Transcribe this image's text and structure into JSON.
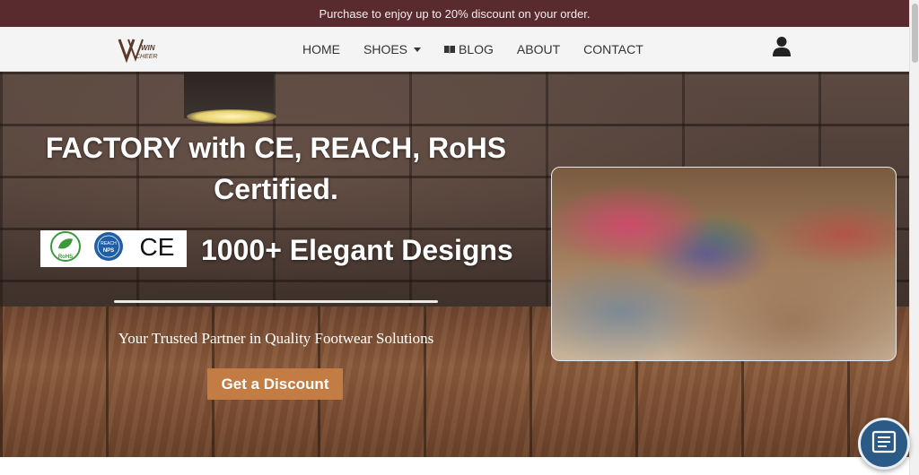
{
  "announcement": {
    "text": "Purchase to enjoy up to 20% discount on your order."
  },
  "brand": {
    "logo_alt": "VVIN CHEER",
    "logo_line1": "WIN",
    "logo_line2": "CHEER"
  },
  "nav": {
    "items": [
      {
        "label": "HOME",
        "icon": null
      },
      {
        "label": "SHOES",
        "icon": "chevron-down-icon"
      },
      {
        "label": "BLOG",
        "icon": "book-icon"
      },
      {
        "label": "ABOUT",
        "icon": null
      },
      {
        "label": "CONTACT",
        "icon": null
      }
    ],
    "account_icon": "user-icon"
  },
  "hero": {
    "headline": "FACTORY with CE, REACH, RoHS Certified.",
    "certifications": [
      "RoHS",
      "REACH",
      "CE"
    ],
    "subhead": "1000+ Elegant Designs",
    "tagline": "Your Trusted Partner in Quality Footwear Solutions",
    "cta_label": "Get a Discount",
    "cert_text": {
      "rohs": "RoHS",
      "reach": "REACH",
      "reach_sub": "NPS",
      "ce": "CE"
    }
  },
  "colors": {
    "announcement_bg": "#5a2b2e",
    "cta_bg": "#c27c44",
    "chat_bg": "#2c5a86"
  },
  "chat_widget": {
    "icon": "form-icon"
  }
}
